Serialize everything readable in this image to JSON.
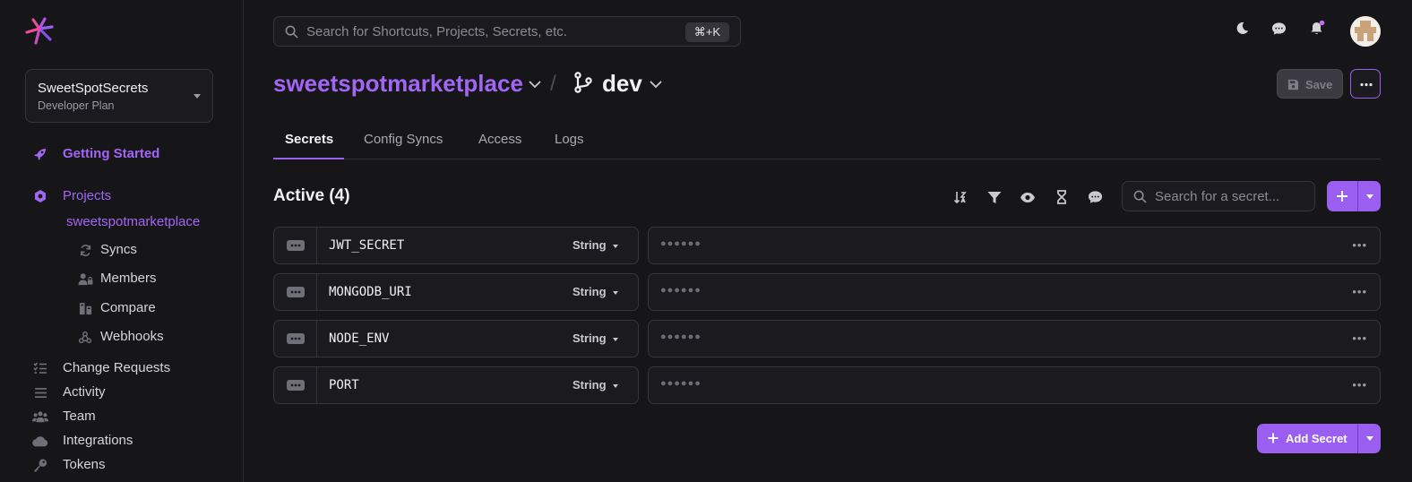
{
  "sidebar": {
    "workspace": {
      "name": "SweetSpotSecrets",
      "plan": "Developer Plan"
    },
    "getting_started": "Getting Started",
    "projects": "Projects",
    "project_name": "sweetspotmarketplace",
    "sub_items": [
      "Syncs",
      "Members",
      "Compare",
      "Webhooks"
    ],
    "items": [
      "Change Requests",
      "Activity",
      "Team",
      "Integrations",
      "Tokens"
    ]
  },
  "header": {
    "search_placeholder": "Search for Shortcuts, Projects, Secrets, etc.",
    "search_shortcut": "⌘+K"
  },
  "breadcrumb": {
    "project": "sweetspotmarketplace",
    "separator": "/",
    "environment": "dev"
  },
  "actions": {
    "save_label": "Save"
  },
  "tabs": [
    "Secrets",
    "Config Syncs",
    "Access",
    "Logs"
  ],
  "secrets": {
    "title": "Active (4)",
    "search_placeholder": "Search for a secret...",
    "add_label": "Add Secret",
    "rows": [
      {
        "key": "JWT_SECRET",
        "type": "String",
        "masked": "●●●●●●"
      },
      {
        "key": "MONGODB_URI",
        "type": "String",
        "masked": "●●●●●●"
      },
      {
        "key": "NODE_ENV",
        "type": "String",
        "masked": "●●●●●●"
      },
      {
        "key": "PORT",
        "type": "String",
        "masked": "●●●●●●"
      }
    ]
  },
  "colors": {
    "accent": "#9a5ff0",
    "accent_text": "#a266f5",
    "background": "#161619",
    "panel": "#1b1b1f"
  }
}
